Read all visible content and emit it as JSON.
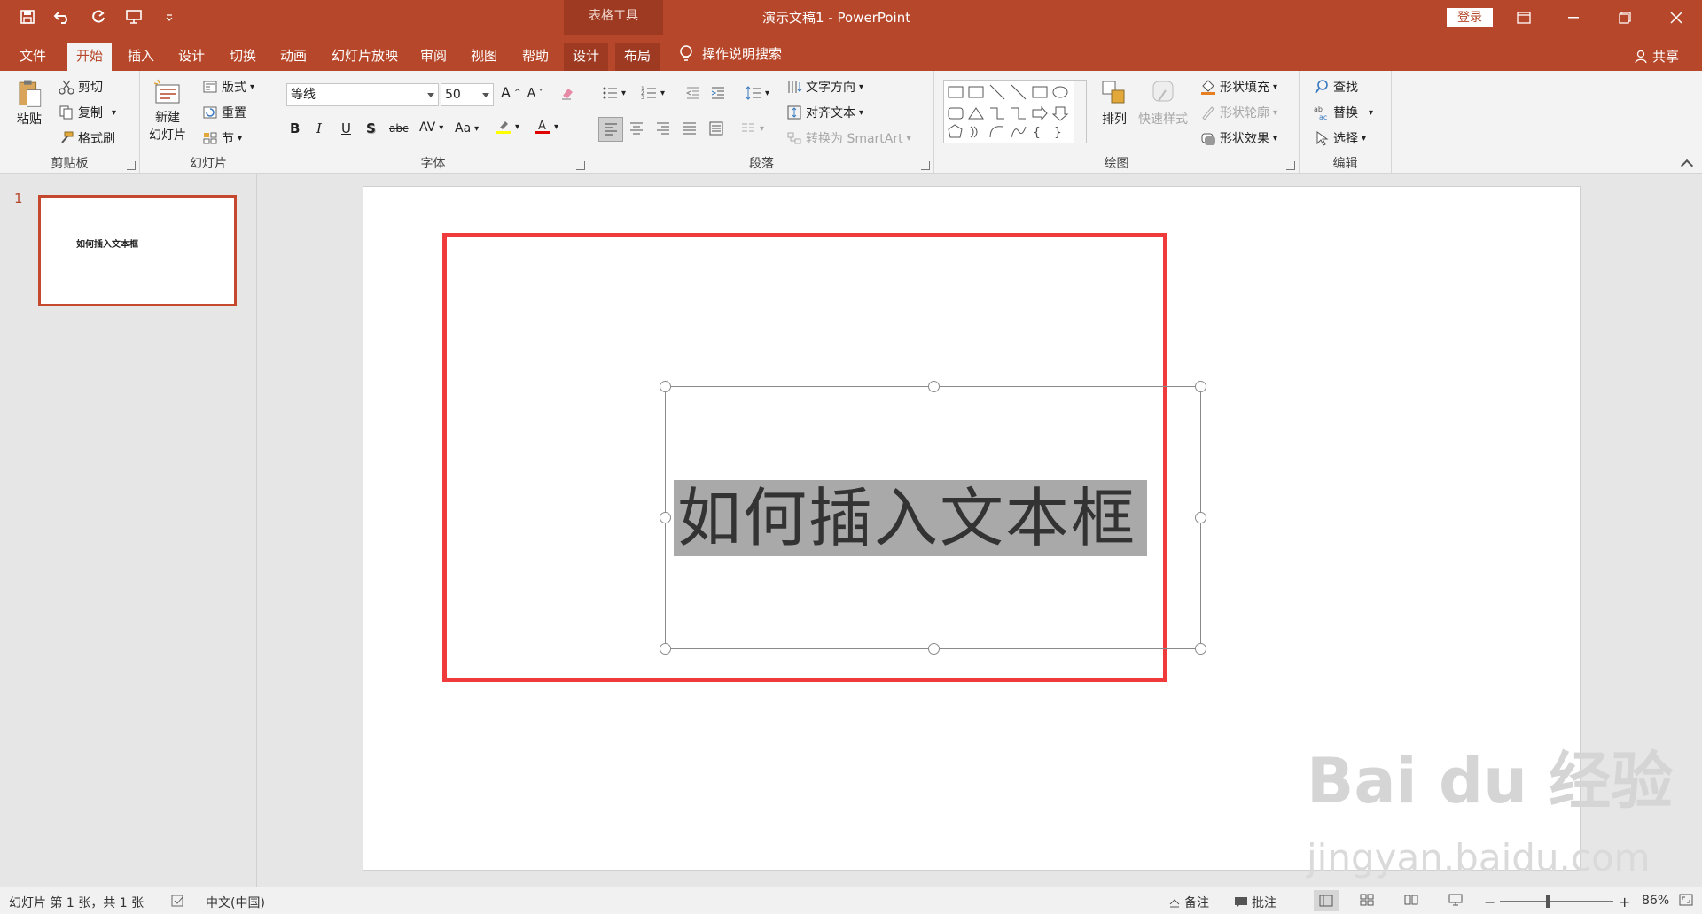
{
  "window": {
    "title": "演示文稿1 - PowerPoint",
    "context_group": "表格工具",
    "login": "登录"
  },
  "tabs": [
    {
      "label": "文件"
    },
    {
      "label": "开始"
    },
    {
      "label": "插入"
    },
    {
      "label": "设计"
    },
    {
      "label": "切换"
    },
    {
      "label": "动画"
    },
    {
      "label": "幻灯片放映"
    },
    {
      "label": "审阅"
    },
    {
      "label": "视图"
    },
    {
      "label": "帮助"
    },
    {
      "label": "设计"
    },
    {
      "label": "布局"
    }
  ],
  "active_tab": "开始",
  "tell_me": "操作说明搜索",
  "share": "共享",
  "ribbon": {
    "clipboard": {
      "label": "剪贴板",
      "paste": "粘贴",
      "cut": "剪切",
      "copy": "复制",
      "format_painter": "格式刷"
    },
    "slides": {
      "label": "幻灯片",
      "new_slide_1": "新建",
      "new_slide_2": "幻灯片",
      "layout": "版式",
      "reset": "重置",
      "section": "节"
    },
    "font": {
      "label": "字体",
      "font_name": "等线",
      "font_size": "50"
    },
    "paragraph": {
      "label": "段落",
      "text_direction": "文字方向",
      "align_text": "对齐文本",
      "smartart": "转换为 SmartArt"
    },
    "drawing": {
      "label": "绘图",
      "arrange": "排列",
      "quick_styles": "快速样式",
      "shape_fill": "形状填充",
      "shape_outline": "形状轮廓",
      "shape_effects": "形状效果"
    },
    "editing": {
      "label": "编辑",
      "find": "查找",
      "replace": "替换",
      "select": "选择"
    }
  },
  "thumbnails": [
    {
      "number": "1",
      "text": "如何插入文本框"
    }
  ],
  "slide": {
    "textbox_text": "如何插入文本框"
  },
  "watermark": {
    "brand": "Bai du 经验",
    "url": "jingyan.baidu.com"
  },
  "status": {
    "slide_info": "幻灯片 第 1 张，共 1 张",
    "language": "中文(中国)",
    "notes": "备注",
    "comments": "批注",
    "zoom": "86%"
  },
  "colors": {
    "accent": "#b7472a",
    "highlight_box": "#ef3b3b"
  }
}
